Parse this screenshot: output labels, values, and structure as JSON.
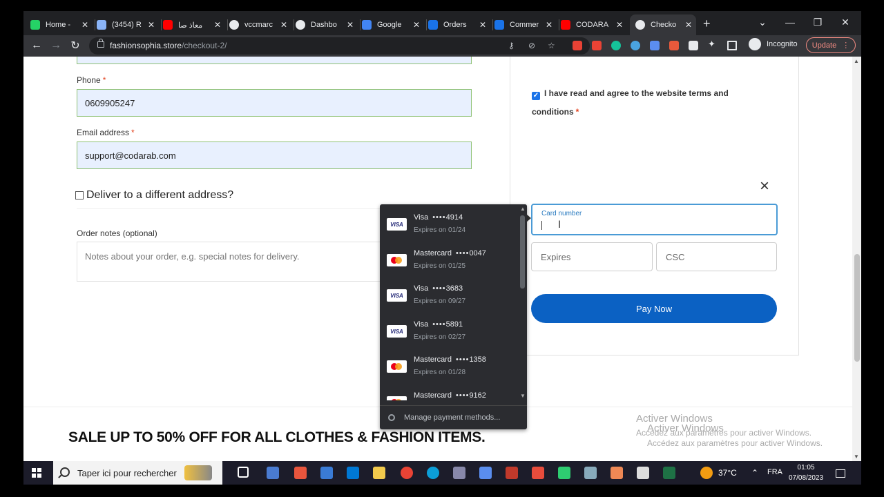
{
  "browser": {
    "tabs": [
      {
        "label": "Home -",
        "color": "#25d366"
      },
      {
        "label": "(3454) R",
        "color": "#8ab4f8"
      },
      {
        "label": "معاذ صا",
        "color": "#ff0000"
      },
      {
        "label": "vccmarc",
        "color": "#e8eaed"
      },
      {
        "label": "Dashbo",
        "color": "#e8eaed"
      },
      {
        "label": "Google",
        "color": "#4285f4"
      },
      {
        "label": "Orders",
        "color": "#1a73e8"
      },
      {
        "label": "Commer",
        "color": "#1a73e8"
      },
      {
        "label": "CODARA",
        "color": "#ff0000"
      },
      {
        "label": "Checko",
        "color": "#e8eaed"
      }
    ],
    "new_tab": "+",
    "url_domain": "fashionsophia.store",
    "url_path": "/checkout-2/",
    "incognito_label": "Incognito",
    "update_label": "Update"
  },
  "form": {
    "phone_label": "Phone",
    "phone_value": "0609905247",
    "email_label": "Email address",
    "email_value": "support@codarab.com",
    "required_mark": "*",
    "deliver_label": "Deliver to a different address?",
    "notes_label": "Order notes (optional)",
    "notes_placeholder": "Notes about your order, e.g. special notes for delivery."
  },
  "payment": {
    "terms_text": "I have read and agree to the website",
    "terms_link": "terms and conditions",
    "card_number_label": "Card number",
    "expires_placeholder": "Expires",
    "csc_placeholder": "CSC",
    "pay_button": "Pay Now",
    "close_icon": "×"
  },
  "autofill": {
    "cards": [
      {
        "brand": "Visa",
        "last4": "4914",
        "expires": "Expires on 01/24"
      },
      {
        "brand": "Mastercard",
        "last4": "0047",
        "expires": "Expires on 01/25"
      },
      {
        "brand": "Visa",
        "last4": "3683",
        "expires": "Expires on 09/27"
      },
      {
        "brand": "Visa",
        "last4": "5891",
        "expires": "Expires on 02/27"
      },
      {
        "brand": "Mastercard",
        "last4": "1358",
        "expires": "Expires on 01/28"
      },
      {
        "brand": "Mastercard",
        "last4": "9162",
        "expires": ""
      }
    ],
    "dots": "••••",
    "visa_logo_text": "VISA",
    "manage_label": "Manage payment methods..."
  },
  "banner": {
    "sale_text": "SALE UP TO 50% OFF FOR ALL CLOTHES & FASHION ITEMS."
  },
  "watermark": {
    "line1": "Activer Windows",
    "line2": "Accédez aux paramètres pour activer Windows.",
    "line3": "Activer Windows",
    "line4": "Accédez aux paramètres pour activer Windows."
  },
  "taskbar": {
    "search_placeholder": "Taper ici pour rechercher",
    "weather": "37°C",
    "language": "FRA",
    "time": "01:05",
    "date": "07/08/2023"
  }
}
